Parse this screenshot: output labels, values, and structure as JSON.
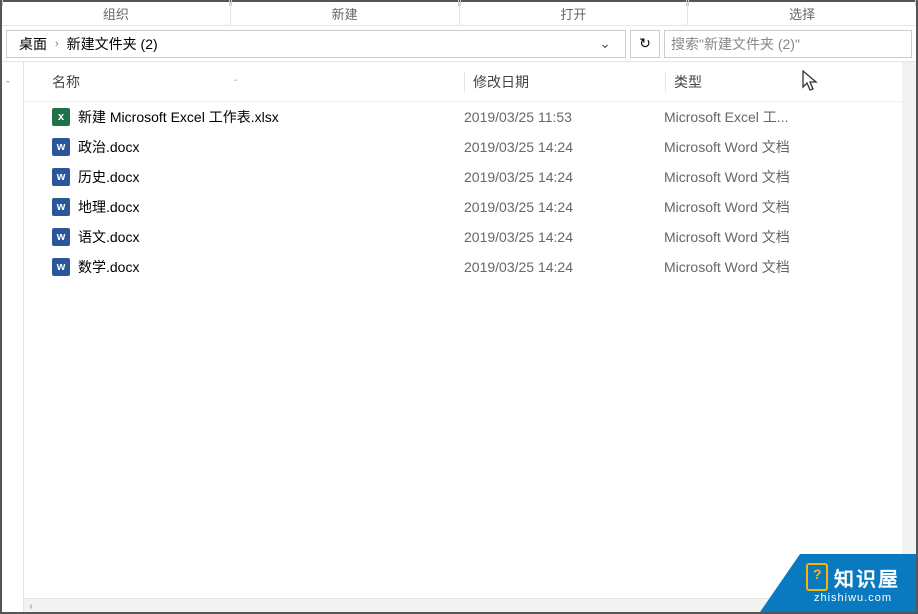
{
  "ribbon_groups": [
    "组织",
    "新建",
    "打开",
    "选择"
  ],
  "breadcrumb": {
    "seg1": "桌面",
    "seg2": "新建文件夹 (2)"
  },
  "search_placeholder": "搜索\"新建文件夹 (2)\"",
  "columns": {
    "name": "名称",
    "date": "修改日期",
    "type": "类型"
  },
  "files": [
    {
      "icon": "excel",
      "name": "新建 Microsoft Excel 工作表.xlsx",
      "date": "2019/03/25 11:53",
      "type": "Microsoft Excel 工..."
    },
    {
      "icon": "word",
      "name": "政治.docx",
      "date": "2019/03/25 14:24",
      "type": "Microsoft Word 文档"
    },
    {
      "icon": "word",
      "name": "历史.docx",
      "date": "2019/03/25 14:24",
      "type": "Microsoft Word 文档"
    },
    {
      "icon": "word",
      "name": "地理.docx",
      "date": "2019/03/25 14:24",
      "type": "Microsoft Word 文档"
    },
    {
      "icon": "word",
      "name": "语文.docx",
      "date": "2019/03/25 14:24",
      "type": "Microsoft Word 文档"
    },
    {
      "icon": "word",
      "name": "数学.docx",
      "date": "2019/03/25 14:24",
      "type": "Microsoft Word 文档"
    }
  ],
  "watermark": {
    "title": "知识屋",
    "url": "zhishiwu.com"
  }
}
